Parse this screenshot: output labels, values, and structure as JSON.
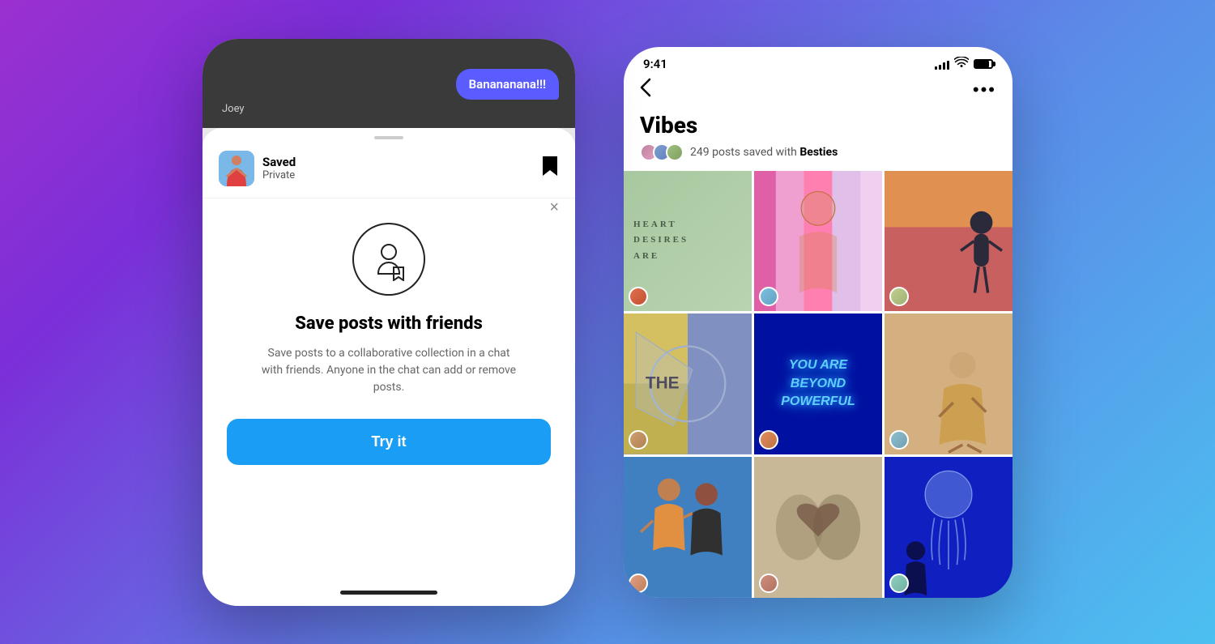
{
  "background": {
    "gradient_start": "#9b30d0",
    "gradient_end": "#4cc0f0"
  },
  "left_phone": {
    "chat_bubble": "Banananana!!!",
    "chat_name": "Joey",
    "sheet_handle": true,
    "saved_header": {
      "title": "Saved",
      "subtitle": "Private",
      "bookmark_icon": "🔖"
    },
    "modal": {
      "close_icon": "×",
      "feature_title": "Save posts with friends",
      "feature_desc": "Save posts to a collaborative collection in a chat with friends. Anyone in the chat can add or remove posts.",
      "cta_label": "Try it"
    },
    "home_indicator": true
  },
  "right_phone": {
    "status_bar": {
      "time": "9:41",
      "signal_bars": [
        4,
        6,
        9,
        11,
        14
      ],
      "battery_label": "battery"
    },
    "nav": {
      "back_icon": "‹",
      "more_icon": "•••"
    },
    "collection": {
      "title": "Vibes",
      "post_count": "249",
      "posts_label": "posts saved with",
      "collaborators_label": "Besties"
    },
    "grid": [
      {
        "id": 1,
        "style": "cell-1",
        "overlay_text": "HEART\nDESIRES\nARE",
        "overlay_class": ""
      },
      {
        "id": 2,
        "style": "cell-2",
        "overlay_text": "",
        "overlay_class": ""
      },
      {
        "id": 3,
        "style": "cell-3",
        "overlay_text": "",
        "overlay_class": ""
      },
      {
        "id": 4,
        "style": "cell-4",
        "overlay_text": "",
        "overlay_class": ""
      },
      {
        "id": 5,
        "style": "cell-5",
        "overlay_text": "YOU ARE\nBEYOND\nPOWERFUL",
        "overlay_class": "center"
      },
      {
        "id": 6,
        "style": "cell-6",
        "overlay_text": "",
        "overlay_class": ""
      },
      {
        "id": 7,
        "style": "cell-7",
        "overlay_text": "",
        "overlay_class": ""
      },
      {
        "id": 8,
        "style": "cell-8",
        "overlay_text": "",
        "overlay_class": ""
      },
      {
        "id": 9,
        "style": "cell-9",
        "overlay_text": "",
        "overlay_class": ""
      }
    ]
  }
}
